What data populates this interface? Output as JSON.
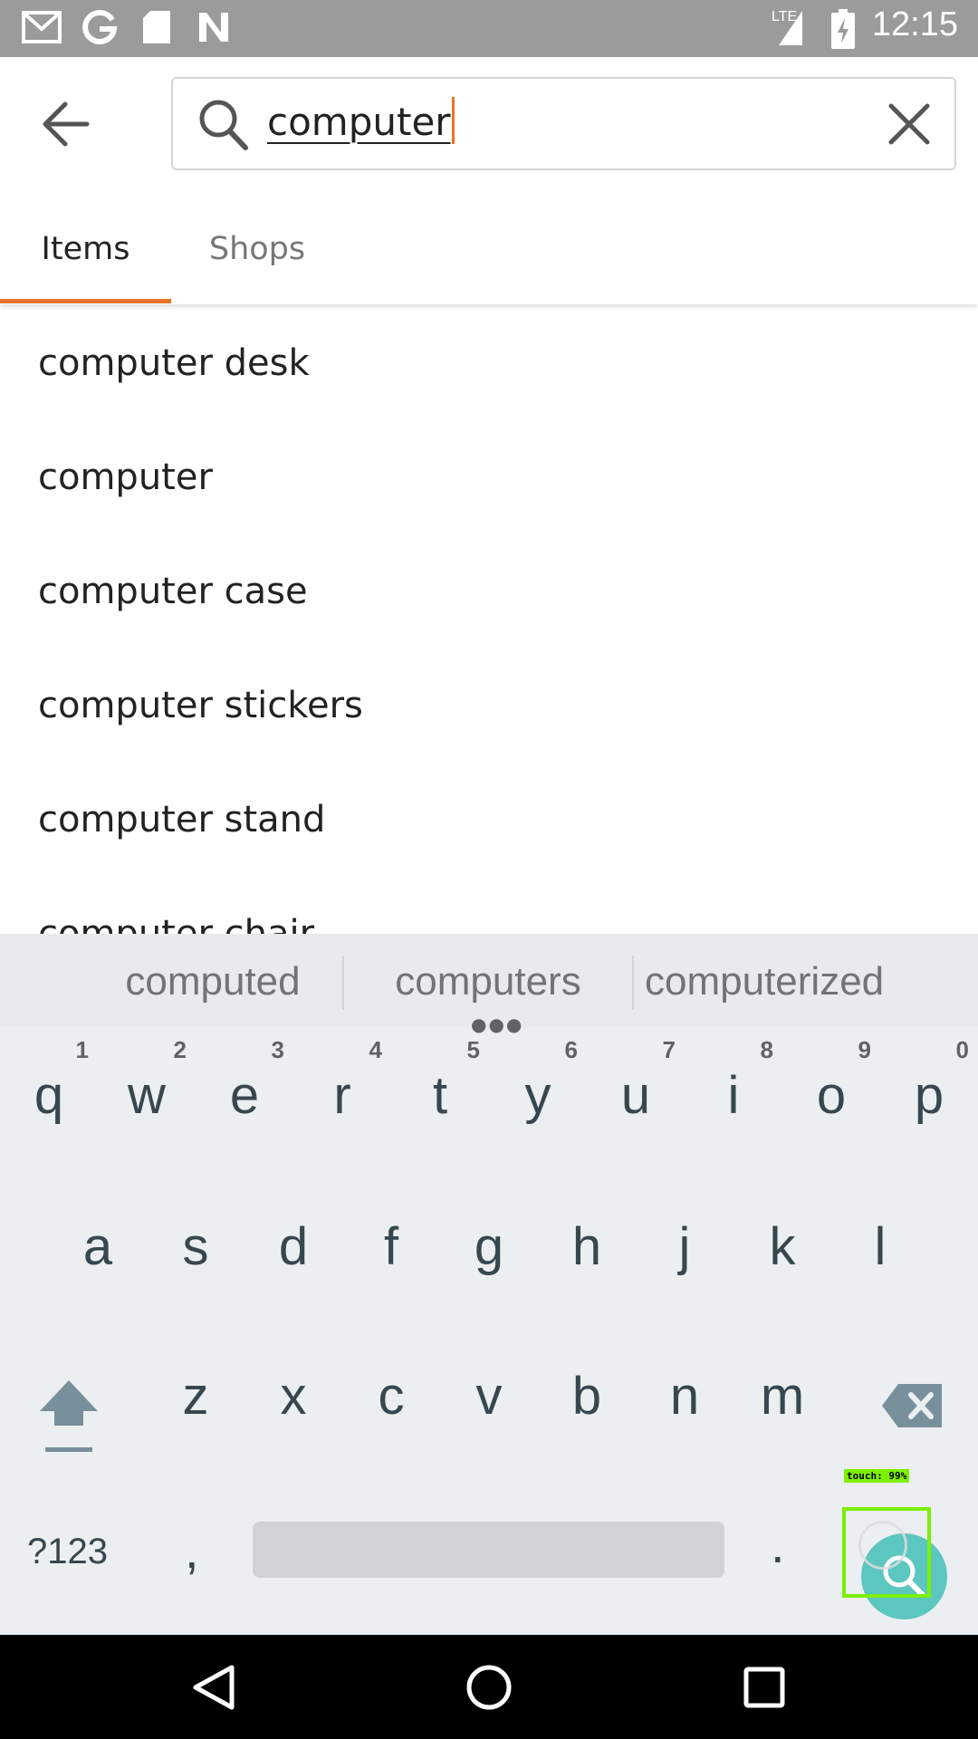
{
  "status_bar": {
    "time": "12:15",
    "left_icons": [
      "gmail-icon",
      "google-icon",
      "sd-card-icon",
      "n-icon"
    ],
    "right_icons": [
      "lte-signal-icon",
      "battery-charging-icon"
    ],
    "network_label": "LTE"
  },
  "search": {
    "query": "computer",
    "back_icon": "arrow-left-icon",
    "search_icon": "search-icon",
    "clear_icon": "close-icon"
  },
  "tabs": [
    {
      "label": "Items",
      "active": true
    },
    {
      "label": "Shops",
      "active": false
    }
  ],
  "suggestions": [
    "computer desk",
    "computer",
    "computer case",
    "computer stickers",
    "computer stand",
    "computer chair"
  ],
  "keyboard": {
    "predictions": [
      "computed",
      "computers",
      "computerized"
    ],
    "row1": [
      {
        "key": "q",
        "hint": "1"
      },
      {
        "key": "w",
        "hint": "2"
      },
      {
        "key": "e",
        "hint": "3"
      },
      {
        "key": "r",
        "hint": "4"
      },
      {
        "key": "t",
        "hint": "5"
      },
      {
        "key": "y",
        "hint": "6"
      },
      {
        "key": "u",
        "hint": "7"
      },
      {
        "key": "i",
        "hint": "8"
      },
      {
        "key": "o",
        "hint": "9"
      },
      {
        "key": "p",
        "hint": "0"
      }
    ],
    "row2": [
      "a",
      "s",
      "d",
      "f",
      "g",
      "h",
      "j",
      "k",
      "l"
    ],
    "row3": [
      "z",
      "x",
      "c",
      "v",
      "b",
      "n",
      "m"
    ],
    "symbols_label": "?123",
    "comma": ",",
    "period": ".",
    "action_icon": "search-icon"
  },
  "touch_overlay": {
    "label": "touch: 99%"
  },
  "nav_bar": {
    "icons": [
      "back-triangle-icon",
      "home-circle-icon",
      "recents-square-icon"
    ]
  },
  "colors": {
    "accent": "#e8742c",
    "status_bar": "#9b9b9b",
    "keyboard_bg": "#eceff1",
    "action_key": "#5cc6c0"
  }
}
